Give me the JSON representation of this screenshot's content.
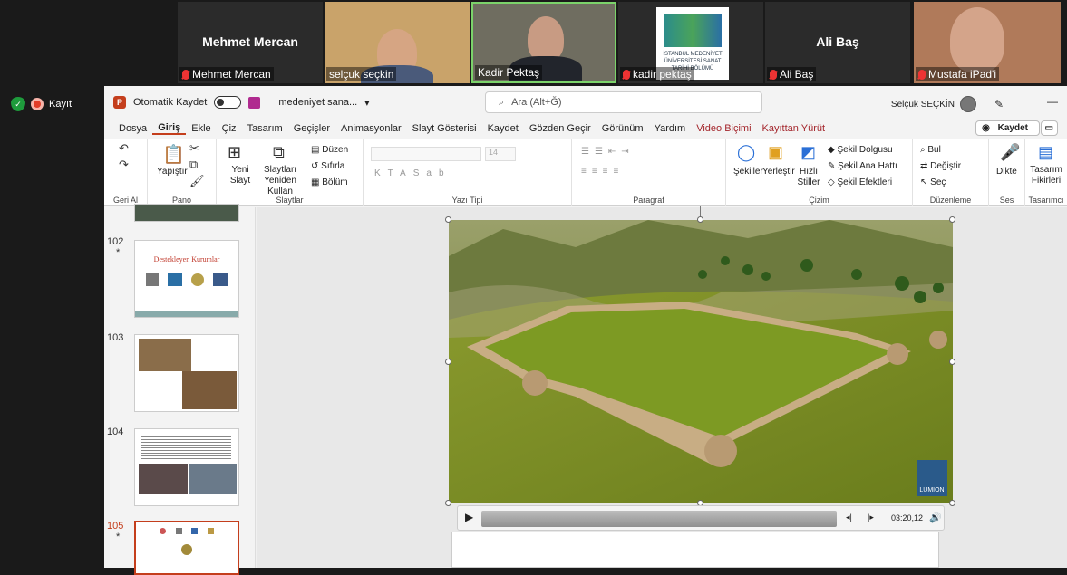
{
  "gallery": {
    "tiles": [
      {
        "big_name": "Mehmet Mercan",
        "label": "Mehmet Mercan",
        "muted": true
      },
      {
        "big_name": "",
        "label": "selçuk seçkin",
        "muted": false
      },
      {
        "big_name": "",
        "label": "Kadir Pektaş",
        "muted": false
      },
      {
        "big_name": "",
        "label": "kadir pektaş",
        "muted": true
      },
      {
        "big_name": "Ali Baş",
        "label": "Ali Baş",
        "muted": true
      },
      {
        "big_name": "",
        "label": "Mustafa iPad'i",
        "muted": true
      }
    ],
    "logo_text": "İSTANBUL MEDENİYET ÜNİVERSİTESİ SANAT TARİHİ BÖLÜMÜ"
  },
  "zoom": {
    "record_label": "Kayıt"
  },
  "ppt": {
    "autosave_label": "Otomatik Kaydet",
    "filename": "medeniyet sana...",
    "search_placeholder": "Ara (Alt+Ğ)",
    "user_name": "Selçuk SEÇKİN",
    "save_button": "Kaydet",
    "tabs": [
      "Dosya",
      "Giriş",
      "Ekle",
      "Çiz",
      "Tasarım",
      "Geçişler",
      "Animasyonlar",
      "Slayt Gösterisi",
      "Kaydet",
      "Gözden Geçir",
      "Görünüm",
      "Yardım"
    ],
    "context_tabs": [
      "Video Biçimi",
      "Kayıttan Yürüt"
    ],
    "ribbon": {
      "undo_group": "Geri Al",
      "paste": "Yapıştır",
      "clipboard_group": "Pano",
      "new_slide": "Yeni Slayt",
      "reuse_slides": "Slaytları Yeniden Kullan",
      "layout": "Düzen",
      "reset": "Sıfırla",
      "section": "Bölüm",
      "slides_group": "Slaytlar",
      "font_size": "14",
      "font_group": "Yazı Tipi",
      "paragraph_group": "Paragraf",
      "shapes": "Şekiller",
      "arrange": "Yerleştir",
      "quick_styles": "Hızlı Stiller",
      "shape_fill": "Şekil Dolgusu",
      "shape_outline": "Şekil Ana Hattı",
      "shape_effects": "Şekil Efektleri",
      "drawing_group": "Çizim",
      "find": "Bul",
      "replace": "Değiştir",
      "select": "Seç",
      "editing_group": "Düzenleme",
      "dictate": "Dikte",
      "voice_group": "Ses",
      "design_ideas": "Tasarım Fikirleri",
      "designer_group": "Tasarımcı"
    },
    "slides": [
      {
        "num": "102",
        "star": "*",
        "title": "Destekleyen Kurumlar"
      },
      {
        "num": "103",
        "star": ""
      },
      {
        "num": "104",
        "star": ""
      },
      {
        "num": "105",
        "star": "*"
      }
    ],
    "video": {
      "time": "03:20,12",
      "watermark": "LUMION"
    }
  }
}
